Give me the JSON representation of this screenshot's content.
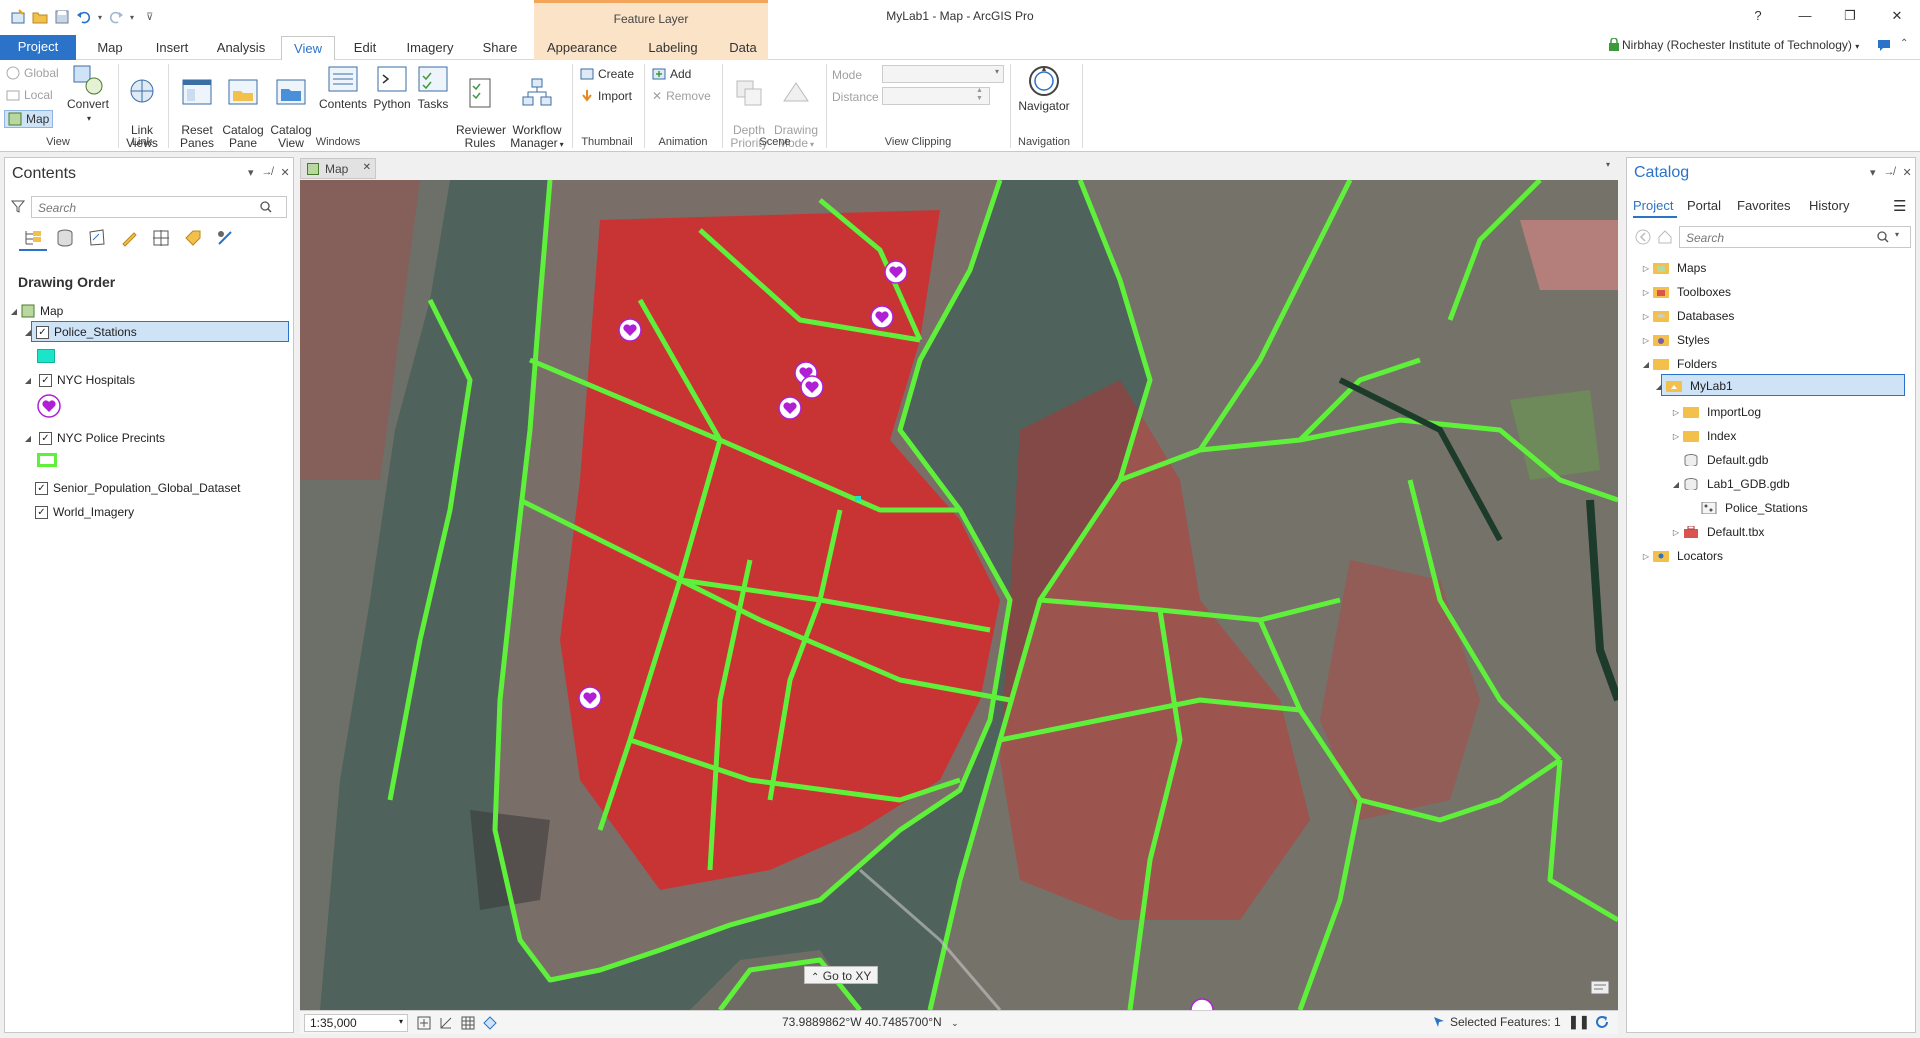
{
  "window": {
    "title": "MyLab1 - Map - ArcGIS Pro",
    "context_tab_header": "Feature Layer",
    "help": "?",
    "user": "Nirbhay (Rochester Institute of Technology)"
  },
  "tabs": [
    "Project",
    "Map",
    "Insert",
    "Analysis",
    "View",
    "Edit",
    "Imagery",
    "Share",
    "Appearance",
    "Labeling",
    "Data"
  ],
  "ribbon": {
    "view_group": {
      "global": "Global",
      "local": "Local",
      "map": "Map",
      "convert": "Convert",
      "label": "View"
    },
    "link_group": {
      "link_views": "Link\nViews",
      "label": "Link"
    },
    "windows_group": {
      "reset_panes": "Reset\nPanes",
      "catalog_pane": "Catalog\nPane",
      "catalog_view": "Catalog\nView",
      "contents": "Contents",
      "python": "Python",
      "tasks": "Tasks",
      "reviewer_rules": "Reviewer\nRules",
      "workflow_manager": "Workflow\nManager",
      "label": "Windows"
    },
    "thumbnail_group": {
      "create": "Create",
      "import": "Import",
      "label": "Thumbnail"
    },
    "animation_group": {
      "add": "Add",
      "remove": "Remove",
      "label": "Animation"
    },
    "scene_group": {
      "depth_priority": "Depth\nPriority",
      "drawing_mode": "Drawing\nMode",
      "label": "Scene"
    },
    "view_clipping_group": {
      "mode": "Mode",
      "distance": "Distance",
      "label": "View Clipping"
    },
    "navigation_group": {
      "navigator": "Navigator",
      "label": "Navigation"
    }
  },
  "contents": {
    "title": "Contents",
    "search_placeholder": "Search",
    "heading": "Drawing Order",
    "map_name": "Map",
    "layers": [
      {
        "name": "Police_Stations",
        "checked": true,
        "selected": true
      },
      {
        "name": "NYC Hospitals",
        "checked": true
      },
      {
        "name": "NYC Police Precints",
        "checked": true
      },
      {
        "name": "Senior_Population_Global_Dataset",
        "checked": true
      },
      {
        "name": "World_Imagery",
        "checked": true
      }
    ]
  },
  "map": {
    "tab_label": "Map",
    "go_to_xy": "Go to XY",
    "scale": "1:35,000",
    "coordinates": "73.9889862°W 40.7485700°N",
    "selected_features": "Selected Features: 1"
  },
  "catalog": {
    "title": "Catalog",
    "tabs": [
      "Project",
      "Portal",
      "Favorites",
      "History"
    ],
    "search_placeholder": "Search",
    "items": {
      "maps": "Maps",
      "toolboxes": "Toolboxes",
      "databases": "Databases",
      "styles": "Styles",
      "folders": "Folders",
      "mylab1": "MyLab1",
      "importlog": "ImportLog",
      "index": "Index",
      "default_gdb": "Default.gdb",
      "lab1_gdb": "Lab1_GDB.gdb",
      "police_stations": "Police_Stations",
      "default_tbx": "Default.tbx",
      "locators": "Locators"
    }
  },
  "colors": {
    "accent": "#2b73c9",
    "precinct_outline": "#5ef03a",
    "population_dots": "#ff1a1a",
    "hospital_symbol": "#b01fd6",
    "police_station_symbol": "#19e6c8",
    "context_tab": "#fbe3c8"
  }
}
